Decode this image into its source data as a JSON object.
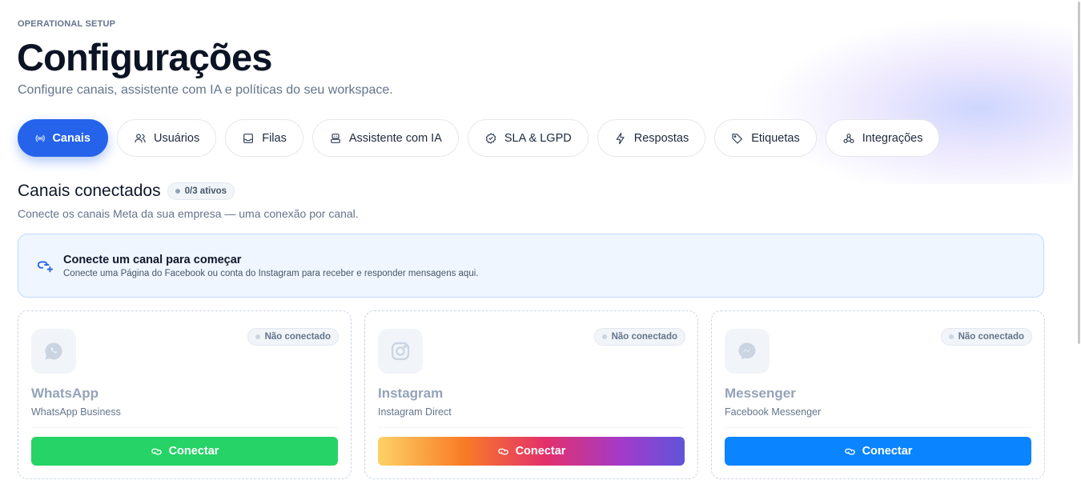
{
  "header": {
    "eyebrow": "OPERATIONAL SETUP",
    "title": "Configurações",
    "subtitle": "Configure canais, assistente com IA e políticas do seu workspace."
  },
  "tabs": [
    {
      "label": "Canais",
      "icon": "broadcast-icon",
      "active": true
    },
    {
      "label": "Usuários",
      "icon": "users-icon",
      "active": false
    },
    {
      "label": "Filas",
      "icon": "inbox-icon",
      "active": false
    },
    {
      "label": "Assistente com IA",
      "icon": "bot-icon",
      "active": false
    },
    {
      "label": "SLA & LGPD",
      "icon": "badge-check-icon",
      "active": false
    },
    {
      "label": "Respostas",
      "icon": "lightning-icon",
      "active": false
    },
    {
      "label": "Etiquetas",
      "icon": "tag-icon",
      "active": false
    },
    {
      "label": "Integrações",
      "icon": "webhook-icon",
      "active": false
    }
  ],
  "section": {
    "title": "Canais conectados",
    "count_badge": "0/3 ativos",
    "subtitle": "Conecte os canais Meta da sua empresa — uma conexão por canal."
  },
  "notice": {
    "icon": "link-plus-icon",
    "title": "Conecte um canal para começar",
    "text": "Conecte uma Página do Facebook ou conta do Instagram para receber e responder mensagens aqui."
  },
  "channels": [
    {
      "name": "WhatsApp",
      "subtitle": "WhatsApp Business",
      "status": "Não conectado",
      "button": "Conectar",
      "icon": "whatsapp-icon",
      "button_color": "#25d366"
    },
    {
      "name": "Instagram",
      "subtitle": "Instagram Direct",
      "status": "Não conectado",
      "button": "Conectar",
      "icon": "instagram-icon",
      "button_color": "gradient"
    },
    {
      "name": "Messenger",
      "subtitle": "Facebook Messenger",
      "status": "Não conectado",
      "button": "Conectar",
      "icon": "messenger-icon",
      "button_color": "#0a84ff"
    }
  ],
  "colors": {
    "accent": "#2563eb",
    "muted": "#64748b"
  }
}
